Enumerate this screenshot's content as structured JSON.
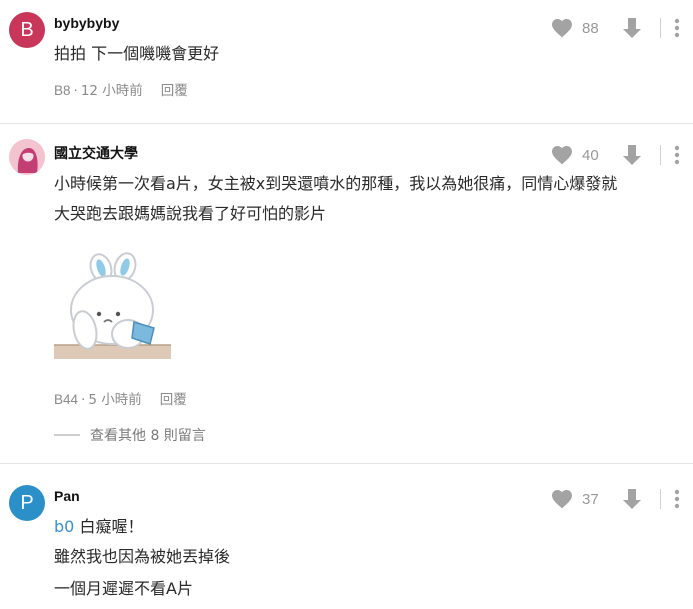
{
  "comments": [
    {
      "avatar_letter": "B",
      "avatar_color": "#c8365a",
      "author": "bybybyby",
      "lines": [
        "拍拍 下一個嘰嘰會更好"
      ],
      "likes": "88",
      "floor": "B8",
      "time": "12 小時前",
      "reply_label": "回覆"
    },
    {
      "avatar_color": "#f3c3cf",
      "author": "國立交通大學",
      "lines": [
        "小時候第一次看a片，女主被x到哭還噴水的那種，我以為她很痛，同情心爆發就",
        "大哭跑去跟媽媽說我看了好可怕的影片"
      ],
      "likes": "40",
      "floor": "B44",
      "time": "5 小時前",
      "reply_label": "回覆",
      "more_replies": "查看其他 8 則留言"
    },
    {
      "avatar_letter": "P",
      "avatar_color": "#2b8fc8",
      "author": "Pan",
      "mention": "b0",
      "lines": [
        "白癡喔！",
        "雖然我也因為被她丟掉後",
        "一個月遲遲不看A片"
      ],
      "likes": "37"
    }
  ],
  "icons": {
    "like": "heart-icon",
    "dislike": "arrow-down-icon",
    "menu": "more-vertical-icon"
  },
  "colors": {
    "icon_gray": "#a3a3a3",
    "mention_blue": "#3b8fd6"
  }
}
